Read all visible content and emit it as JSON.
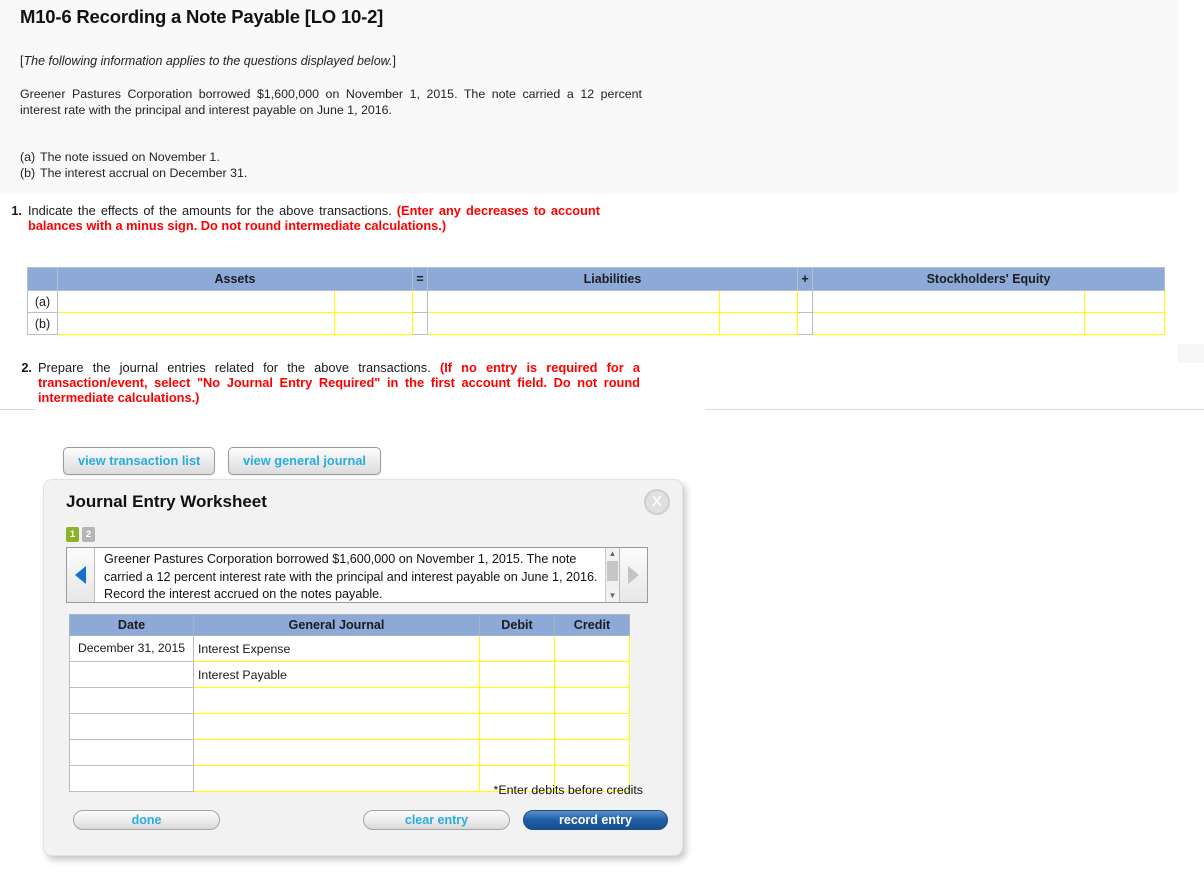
{
  "page": {
    "title": "M10-6 Recording a Note Payable [LO 10-2]",
    "applies_prefix": "[",
    "applies_italic": "The following information applies to the questions displayed below.",
    "applies_suffix": "]",
    "intro": "Greener Pastures Corporation borrowed $1,600,000 on November 1, 2015. The note carried a 12 percent interest rate with the principal and interest payable on June 1, 2016.",
    "events": [
      {
        "tag": "(a)",
        "text": "The note issued on November 1."
      },
      {
        "tag": "(b)",
        "text": "The interest accrual on December 31."
      }
    ]
  },
  "requirements": [
    {
      "number": "1.",
      "black": "Indicate the effects of the amounts for the above transactions.",
      "red": "(Enter any decreases to account balances with a minus sign. Do not round intermediate calculations.)"
    },
    {
      "number": "2.",
      "black": "Prepare the journal entries related for the above transactions.",
      "red": "(If no entry is required for a transaction/event, select \"No Journal Entry Required\" in the first account field. Do not round intermediate calculations.)"
    }
  ],
  "effects_table": {
    "headers": {
      "corner": "",
      "assets": "Assets",
      "equals": "=",
      "liabilities": "Liabilities",
      "plus": "+",
      "equity": "Stockholders' Equity"
    },
    "rows": [
      {
        "label": "(a)",
        "assets_name": "",
        "assets_amt": "",
        "liab_name": "",
        "liab_amt": "",
        "equity_name": "",
        "equity_amt": ""
      },
      {
        "label": "(b)",
        "assets_name": "",
        "assets_amt": "",
        "liab_name": "",
        "liab_amt": "",
        "equity_name": "",
        "equity_amt": ""
      }
    ]
  },
  "view_buttons": {
    "transaction_list": "view transaction list",
    "general_journal": "view general journal"
  },
  "worksheet": {
    "title": "Journal Entry Worksheet",
    "close_label": "X",
    "tabs": [
      {
        "label": "1",
        "state": "active"
      },
      {
        "label": "2",
        "state": "idle"
      }
    ],
    "prompt": "Greener Pastures Corporation borrowed $1,600,000 on November 1, 2015. The note carried a 12 percent interest rate with the principal and interest payable on June 1, 2016. Record the interest accrued on the notes payable.",
    "prev_arrow": "prev",
    "next_arrow": "next",
    "journal": {
      "headers": [
        "Date",
        "General Journal",
        "Debit",
        "Credit"
      ],
      "rows": [
        {
          "date": "December 31, 2015",
          "account": "Interest Expense",
          "debit": "",
          "credit": ""
        },
        {
          "date": "",
          "account": "Interest Payable",
          "debit": "",
          "credit": ""
        },
        {
          "date": "",
          "account": "",
          "debit": "",
          "credit": ""
        },
        {
          "date": "",
          "account": "",
          "debit": "",
          "credit": ""
        },
        {
          "date": "",
          "account": "",
          "debit": "",
          "credit": ""
        },
        {
          "date": "",
          "account": "",
          "debit": "",
          "credit": ""
        }
      ]
    },
    "note": "*Enter debits before credits",
    "buttons": {
      "done": "done",
      "clear_entry": "clear entry",
      "record_entry": "record entry"
    }
  },
  "colors": {
    "header_blue": "#8da9d8",
    "input_yellow": "#ffff00",
    "link_blue": "#29ace3",
    "red": "#ff0000",
    "tab_green": "#8cb32a",
    "record_blue": "#1f5fa6"
  }
}
